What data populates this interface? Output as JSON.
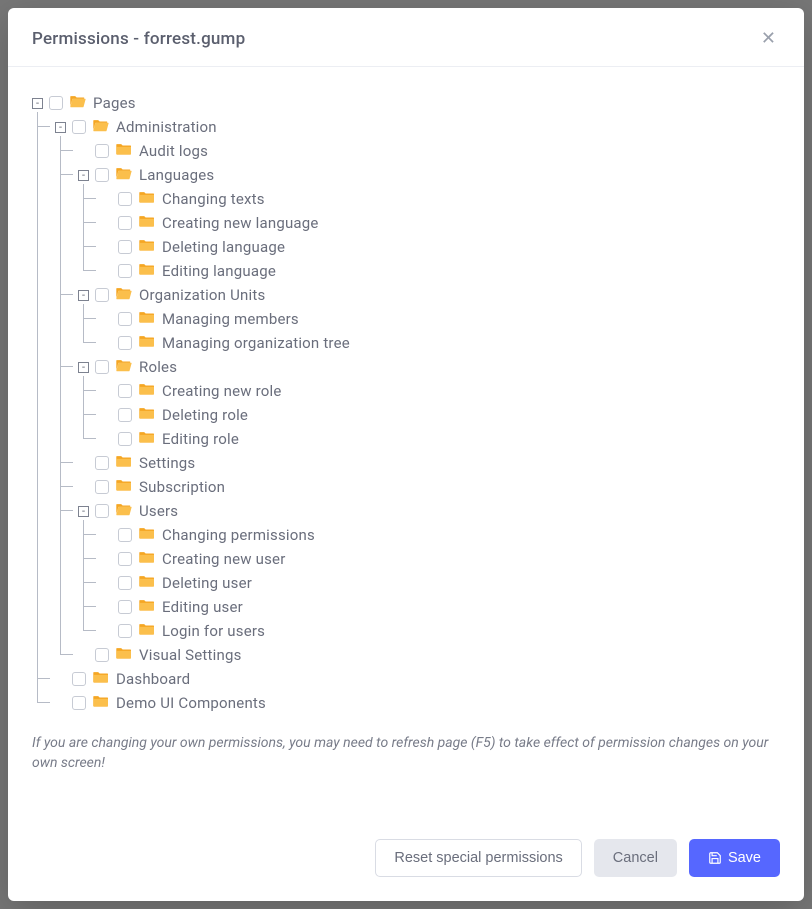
{
  "dialog": {
    "title": "Permissions - forrest.gump",
    "hint": "If you are changing your own permissions, you may need to refresh page (F5) to take effect of permission changes on your own screen!"
  },
  "buttons": {
    "reset": "Reset special permissions",
    "cancel": "Cancel",
    "save": "Save"
  },
  "tree": [
    {
      "id": "pages",
      "label": "Pages",
      "open": true,
      "children": [
        {
          "id": "administration",
          "label": "Administration",
          "open": true,
          "children": [
            {
              "id": "audit-logs",
              "label": "Audit logs"
            },
            {
              "id": "languages",
              "label": "Languages",
              "open": true,
              "children": [
                {
                  "id": "changing-texts",
                  "label": "Changing texts"
                },
                {
                  "id": "creating-new-language",
                  "label": "Creating new language"
                },
                {
                  "id": "deleting-language",
                  "label": "Deleting language"
                },
                {
                  "id": "editing-language",
                  "label": "Editing language"
                }
              ]
            },
            {
              "id": "organization-units",
              "label": "Organization Units",
              "open": true,
              "children": [
                {
                  "id": "managing-members",
                  "label": "Managing members"
                },
                {
                  "id": "managing-organization-tree",
                  "label": "Managing organization tree"
                }
              ]
            },
            {
              "id": "roles",
              "label": "Roles",
              "open": true,
              "children": [
                {
                  "id": "creating-new-role",
                  "label": "Creating new role"
                },
                {
                  "id": "deleting-role",
                  "label": "Deleting role"
                },
                {
                  "id": "editing-role",
                  "label": "Editing role"
                }
              ]
            },
            {
              "id": "settings",
              "label": "Settings"
            },
            {
              "id": "subscription",
              "label": "Subscription"
            },
            {
              "id": "users",
              "label": "Users",
              "open": true,
              "children": [
                {
                  "id": "changing-permissions",
                  "label": "Changing permissions"
                },
                {
                  "id": "creating-new-user",
                  "label": "Creating new user"
                },
                {
                  "id": "deleting-user",
                  "label": "Deleting user"
                },
                {
                  "id": "editing-user",
                  "label": "Editing user"
                },
                {
                  "id": "login-for-users",
                  "label": "Login for users"
                }
              ]
            },
            {
              "id": "visual-settings",
              "label": "Visual Settings"
            }
          ]
        },
        {
          "id": "dashboard",
          "label": "Dashboard"
        },
        {
          "id": "demo-ui-components",
          "label": "Demo UI Components"
        }
      ]
    }
  ]
}
